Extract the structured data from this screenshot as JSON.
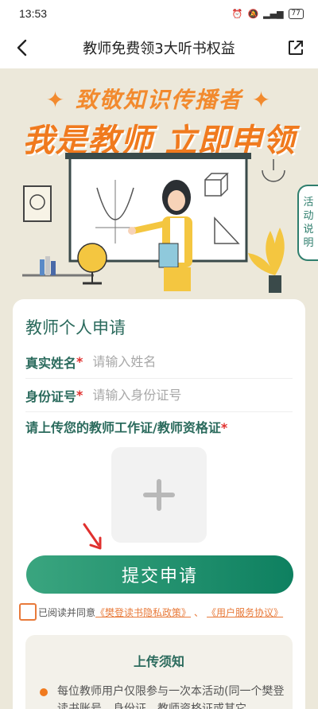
{
  "status_bar": {
    "time": "13:53",
    "battery": "77"
  },
  "nav": {
    "title": "教师免费领3大听书权益"
  },
  "hero": {
    "subtitle": "✦ 致敬知识传播者 ✦",
    "title": "我是教师 立即申领"
  },
  "side_tab": {
    "label": [
      "活",
      "动",
      "说",
      "明"
    ]
  },
  "form": {
    "title": "教师个人申请",
    "name": {
      "label": "真实姓名",
      "required": "*",
      "placeholder": "请输入姓名"
    },
    "id": {
      "label": "身份证号",
      "required": "*",
      "placeholder": "请输入身份证号"
    },
    "upload": {
      "label": "请上传您的教师工作证/教师资格证",
      "required": "*"
    },
    "submit_label": "提交申请"
  },
  "agreement": {
    "prefix": "已阅读并同意",
    "privacy_link": "《樊登读书隐私政策》",
    "separator": "、",
    "service_link": "《用户服务协议》"
  },
  "notice": {
    "title": "上传须知",
    "items": [
      "每位教师用户仅限参与一次本活动(同一个樊登读书账号、身份证、教师资格证或其它"
    ]
  },
  "colors": {
    "primary": "#2a6a5c",
    "accent": "#f07a1e",
    "button_start": "#3aa57f",
    "button_end": "#0e8060"
  }
}
